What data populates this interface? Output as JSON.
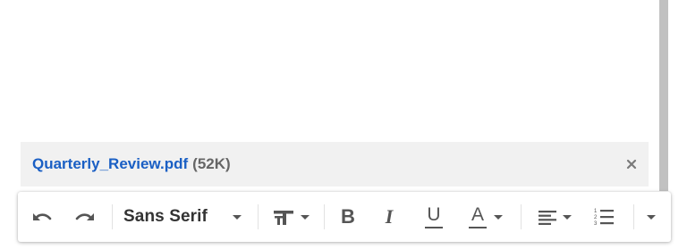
{
  "attachment": {
    "filename": "Quarterly_Review.pdf",
    "size": "(52K)",
    "remove_icon": "close-icon"
  },
  "toolbar": {
    "undo_icon": "undo-icon",
    "redo_icon": "redo-icon",
    "font_family": "Sans Serif",
    "font_size_icon": "font-size-icon",
    "bold_label": "B",
    "italic_label": "I",
    "underline_label": "U",
    "text_color_label": "A",
    "align_icon": "align-left-icon",
    "numbered_list_icon": "numbered-list-icon",
    "more_options_icon": "chevron-down-icon"
  },
  "colors": {
    "link_blue": "#1a5fc4",
    "icon_gray": "#555555",
    "attachment_bg": "#f1f1f1",
    "scrollbar": "#c1c1c1"
  }
}
